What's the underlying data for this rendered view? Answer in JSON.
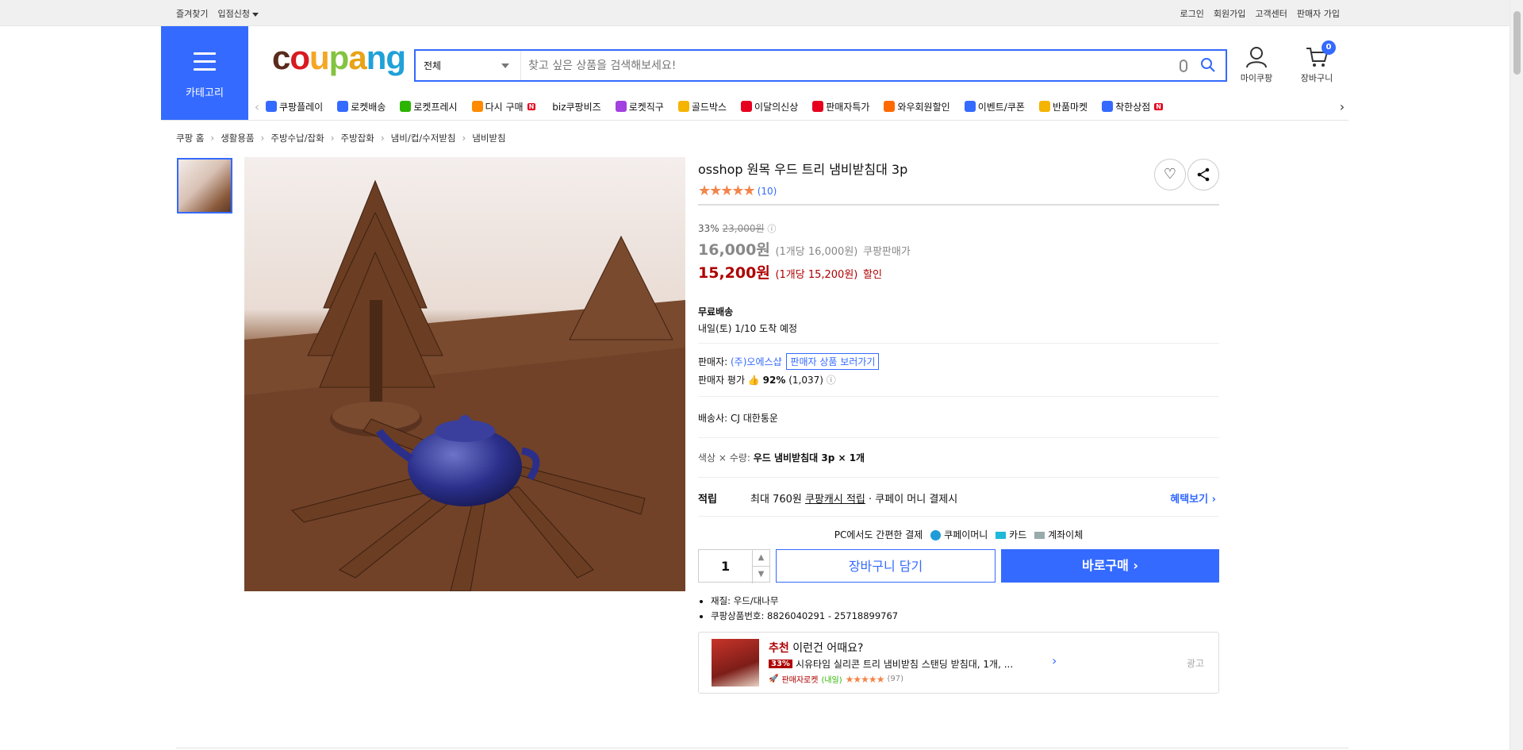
{
  "topbar": {
    "left": [
      "즐겨찾기",
      "입점신청"
    ],
    "right": [
      "로그인",
      "회원가입",
      "고객센터",
      "판매자 가입"
    ]
  },
  "header": {
    "category_label": "카테고리",
    "logo": {
      "c1": "c",
      "c2": "o",
      "c3": "u",
      "c4": "p",
      "c5": "a",
      "c6": "n",
      "c7": "g"
    },
    "search_scope": "전체",
    "search_placeholder": "찾고 싶은 상품을 검색해보세요!",
    "mycoupang": "마이쿠팡",
    "cart": "장바구니",
    "cart_count": "0"
  },
  "quicknav": [
    {
      "label": "쿠팡플레이",
      "color": "#346aff"
    },
    {
      "label": "로켓배송",
      "color": "#346aff"
    },
    {
      "label": "로켓프레시",
      "color": "#2db400"
    },
    {
      "label": "다시 구매",
      "color": "#ff8a00",
      "new": "N"
    },
    {
      "label": "biz쿠팡비즈",
      "color": "#ffffff"
    },
    {
      "label": "로켓직구",
      "color": "#a240e0"
    },
    {
      "label": "골드박스",
      "color": "#f5b400"
    },
    {
      "label": "이달의신상",
      "color": "#e6001e"
    },
    {
      "label": "판매자특가",
      "color": "#e6001e"
    },
    {
      "label": "와우회원할인",
      "color": "#ff6a00"
    },
    {
      "label": "이벤트/쿠폰",
      "color": "#346aff"
    },
    {
      "label": "반품마켓",
      "color": "#f5b400"
    },
    {
      "label": "착한상점",
      "color": "#346aff",
      "new": "N"
    }
  ],
  "breadcrumb": [
    "쿠팡 홈",
    "생활용품",
    "주방수납/잡화",
    "주방잡화",
    "냄비/컵/수저받침",
    "냄비받침"
  ],
  "product": {
    "title": "osshop 원목 우드 트리 냄비받침대 3p",
    "rating_stars": 5,
    "review_count": "(10)",
    "discount": "33%",
    "original_price": "23,000원",
    "price": "16,000원",
    "price_unit": "(1개당 16,000원)",
    "price_note": "쿠팡판매가",
    "sale_price": "15,200원",
    "sale_unit": "(1개당 15,200원)",
    "sale_note": "할인",
    "shipping_title": "무료배송",
    "shipping_date": "내일(토) 1/10 도착 예정",
    "seller_label": "판매자:",
    "seller_name": "(주)오에스샵",
    "seller_products_btn": "판매자 상품 보러가기",
    "seller_rating_label": "판매자 평가",
    "seller_rating_pct": "92%",
    "seller_rating_count": "(1,037)",
    "carrier_label": "배송사:",
    "carrier": "CJ 대한통운",
    "option_label": "색상 × 수량:",
    "option_value": "우드 냄비받침대 3p × 1개",
    "points_label": "적립",
    "points_text": "최대 760원",
    "points_link": "쿠팡캐시 적립",
    "points_suffix": "· 쿠페이 머니 결제시",
    "benefit_btn": "혜택보기",
    "pay_title": "PC에서도 간편한 결제",
    "pay_methods": [
      "쿠페이머니",
      "카드",
      "계좌이체"
    ],
    "quantity": "1",
    "cart_btn": "장바구니 담기",
    "buy_btn": "바로구매",
    "attributes": [
      "재질: 우드/대나무",
      "쿠팡상품번호: 8826040291 - 25718899767"
    ]
  },
  "recommend": {
    "tag": "추천",
    "heading": "이런건 어때요?",
    "discount": "33%",
    "name": "시유타임 실리콘 트리 냄비받침 스탠딩 받침대, 1개, ...",
    "badge": "판매자로켓",
    "badge_sub": "(내일)",
    "count": "(97)",
    "ad": "광고"
  }
}
